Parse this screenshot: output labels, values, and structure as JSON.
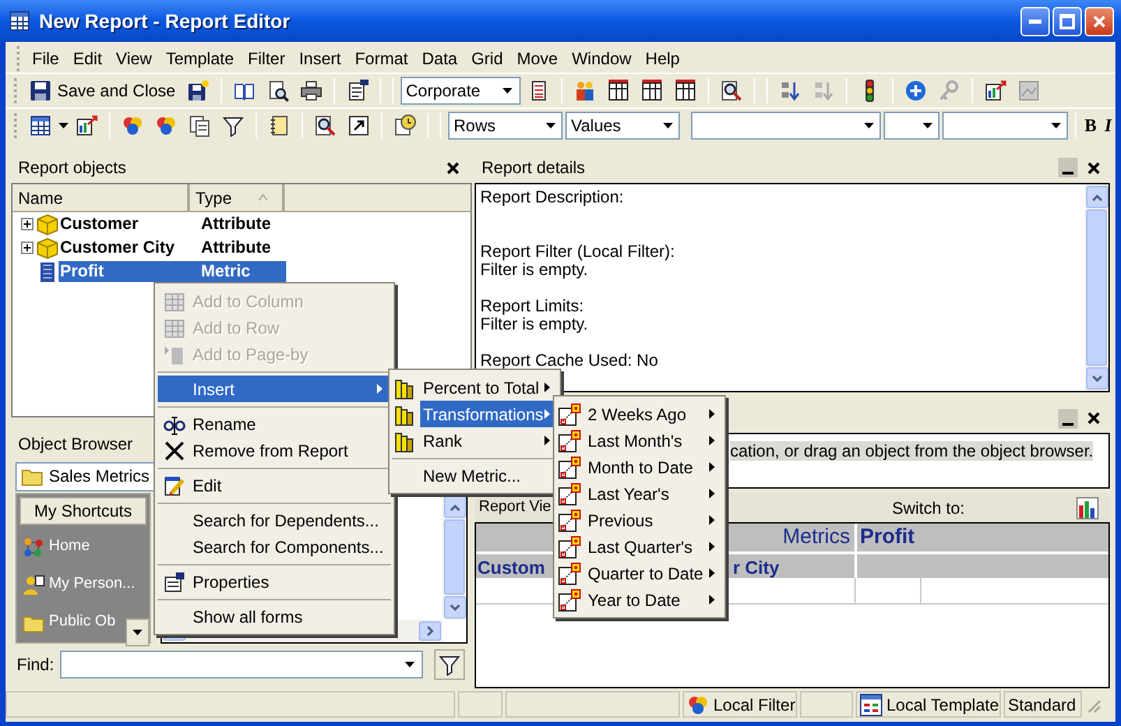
{
  "window": {
    "title": "New Report - Report Editor"
  },
  "menu_bar": [
    "File",
    "Edit",
    "View",
    "Template",
    "Filter",
    "Insert",
    "Format",
    "Data",
    "Grid",
    "Move",
    "Window",
    "Help"
  ],
  "toolbar": {
    "save_button": "Save and Close",
    "style_dropdown": "Corporate"
  },
  "format_toolbar": {
    "dropdowns": [
      "Rows",
      "Values"
    ],
    "bold_button": "B",
    "italic_button": "I"
  },
  "report_objects": {
    "title": "Report objects",
    "columns": [
      "Name",
      "Type"
    ],
    "rows": [
      {
        "name": "Customer",
        "type": "Attribute",
        "kind": "attribute",
        "selected": false
      },
      {
        "name": "Customer City",
        "type": "Attribute",
        "kind": "attribute",
        "selected": false
      },
      {
        "name": "Profit",
        "type": "Metric",
        "kind": "metric",
        "selected": true
      }
    ]
  },
  "object_browser": {
    "title": "Object Browser",
    "folder": "Sales Metrics",
    "shortcuts_button": "My Shortcuts",
    "shortcuts": [
      "Home",
      "My Person...",
      "Public Ob"
    ],
    "find_label": "Find:"
  },
  "report_details": {
    "title": "Report details",
    "paragraphs": [
      [
        "Report Description:"
      ],
      [
        "Report Filter (Local Filter):",
        "Filter is empty."
      ],
      [
        "Report Limits:",
        "Filter is empty."
      ],
      [
        "Report Cache Used: No"
      ]
    ]
  },
  "message_panel": {
    "text": "cation, or drag an object from the object browser."
  },
  "report_view": {
    "title": "Report Vie",
    "switch_label": "Switch to:",
    "column_header_label": "Metrics",
    "columns": [
      "Profit"
    ],
    "row_headers": [
      "Custom",
      "r City"
    ]
  },
  "context_menu": {
    "sections": [
      [
        {
          "label": "Add to Column",
          "disabled": true,
          "selected": false,
          "submenu": false
        },
        {
          "label": "Add to Row",
          "disabled": true,
          "selected": false,
          "submenu": false
        },
        {
          "label": "Add to Page-by",
          "disabled": true,
          "selected": false,
          "submenu": false
        }
      ],
      [
        {
          "label": "Insert",
          "disabled": false,
          "selected": true,
          "submenu": true
        }
      ],
      [
        {
          "label": "Rename",
          "disabled": false,
          "selected": false,
          "submenu": false
        },
        {
          "label": "Remove from Report",
          "disabled": false,
          "selected": false,
          "submenu": false
        }
      ],
      [
        {
          "label": "Edit",
          "disabled": false,
          "selected": false,
          "submenu": false
        }
      ],
      [
        {
          "label": "Search for Dependents...",
          "disabled": false,
          "selected": false,
          "submenu": false
        },
        {
          "label": "Search for Components...",
          "disabled": false,
          "selected": false,
          "submenu": false
        }
      ],
      [
        {
          "label": "Properties",
          "disabled": false,
          "selected": false,
          "submenu": false
        }
      ],
      [
        {
          "label": "Show all forms",
          "disabled": false,
          "selected": false,
          "submenu": false
        }
      ]
    ]
  },
  "insert_submenu": {
    "sections": [
      [
        {
          "label": "Percent to Total",
          "selected": false,
          "submenu": true
        },
        {
          "label": "Transformations",
          "selected": true,
          "submenu": true
        },
        {
          "label": "Rank",
          "selected": false,
          "submenu": true
        }
      ],
      [
        {
          "label": "New Metric...",
          "selected": false,
          "submenu": false
        }
      ]
    ]
  },
  "transformations_submenu": {
    "items": [
      {
        "label": "2 Weeks Ago",
        "selected": false,
        "submenu": true
      },
      {
        "label": "Last Month's",
        "selected": false,
        "submenu": true
      },
      {
        "label": "Month to Date",
        "selected": false,
        "submenu": true
      },
      {
        "label": "Last Year's",
        "selected": false,
        "submenu": true
      },
      {
        "label": "Previous",
        "selected": false,
        "submenu": true
      },
      {
        "label": "Last Quarter's",
        "selected": false,
        "submenu": true
      },
      {
        "label": "Quarter to Date",
        "selected": false,
        "submenu": true
      },
      {
        "label": "Year to Date",
        "selected": false,
        "submenu": true
      }
    ]
  },
  "status_bar": [
    {
      "label": "Local Filter",
      "kind": "filter"
    },
    {
      "label": "Local Template",
      "kind": "template"
    },
    {
      "label": "Standard",
      "kind": "plain"
    }
  ]
}
